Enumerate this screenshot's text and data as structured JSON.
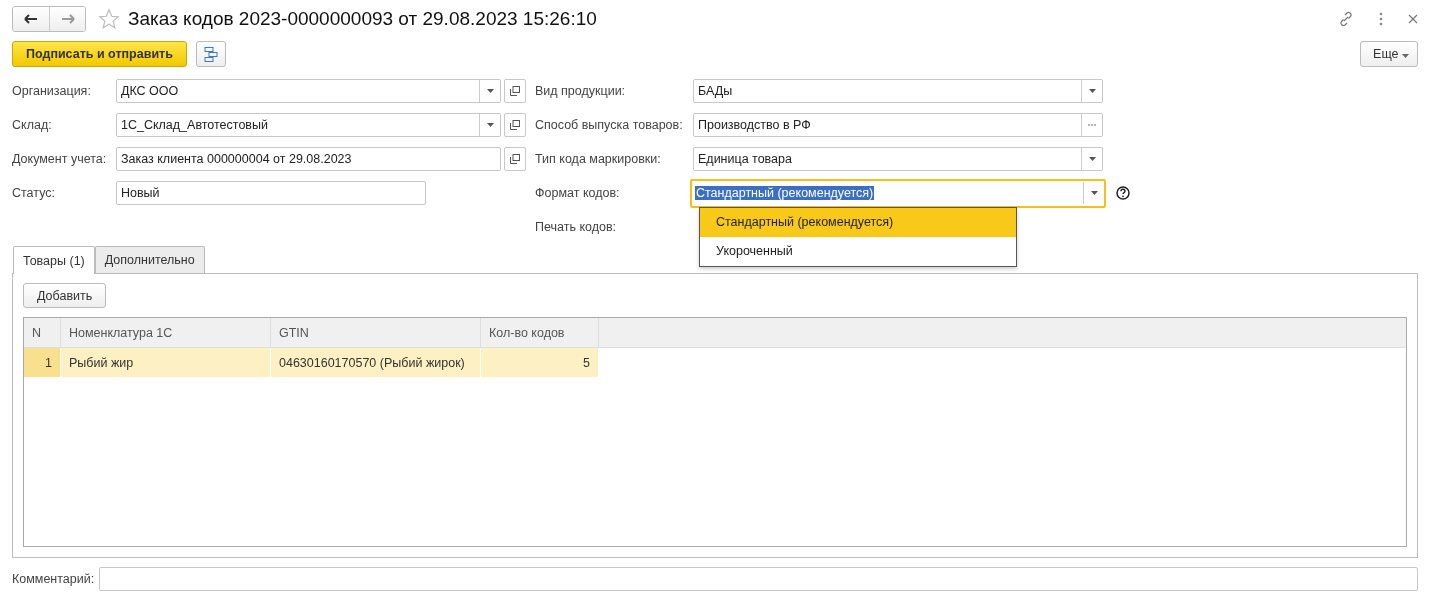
{
  "window": {
    "title": "Заказ кодов 2023-0000000093 от 29.08.2023 15:26:10"
  },
  "toolbar": {
    "primary_button": "Подписать и отправить",
    "more_button": "Еще"
  },
  "left_fields": [
    {
      "label": "Организация:",
      "value": "ДКС ООО",
      "kind": "select-open"
    },
    {
      "label": "Склад:",
      "value": "1С_Склад_Автотестовый",
      "kind": "select-open"
    },
    {
      "label": "Документ учета:",
      "value": "Заказ клиента 000000004 от 29.08.2023",
      "kind": "open"
    },
    {
      "label": "Статус:",
      "value": "Новый",
      "kind": "plain"
    }
  ],
  "right_fields": [
    {
      "label": "Вид продукции:",
      "value": "БАДы",
      "kind": "select",
      "focused": false
    },
    {
      "label": "Способ выпуска товаров:",
      "value": "Производство в РФ",
      "kind": "choose",
      "focused": false
    },
    {
      "label": "Тип кода маркировки:",
      "value": "Единица товара",
      "kind": "select",
      "focused": false
    },
    {
      "label": "Формат кодов:",
      "value": "Стандартный (рекомендуется)",
      "kind": "select",
      "focused": true
    },
    {
      "label": "Печать кодов:",
      "kind": "label"
    }
  ],
  "dropdown": {
    "options": [
      {
        "label": "Стандартный (рекомендуется)",
        "selected": true
      },
      {
        "label": "Укороченный",
        "selected": false
      }
    ]
  },
  "tabs": [
    {
      "label": "Товары (1)",
      "selected": true
    },
    {
      "label": "Дополнительно",
      "selected": false
    }
  ],
  "add_button": "Добавить",
  "table": {
    "columns": [
      "N",
      "Номенклатура 1С",
      "GTIN",
      "Кол-во кодов"
    ],
    "rows": [
      {
        "cells": [
          "1",
          "Рыбий жир",
          "04630160170570 (Рыбий жирок)",
          "5"
        ],
        "selected": true
      }
    ]
  },
  "comment": {
    "label": "Комментарий:"
  }
}
